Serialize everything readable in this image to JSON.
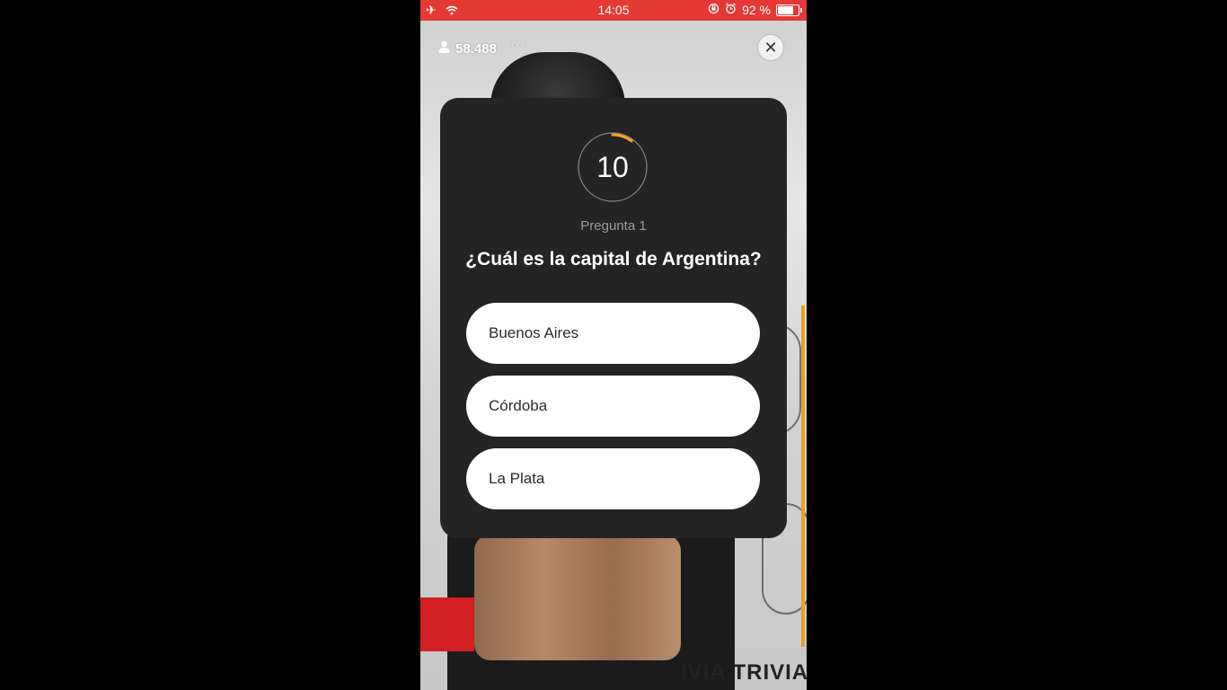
{
  "status_bar": {
    "time": "14:05",
    "battery_text": "92 %",
    "battery_level": 0.92,
    "icons": [
      "airplane-icon",
      "wifi-icon",
      "orientation-lock-icon",
      "alarm-icon",
      "battery-icon"
    ]
  },
  "header": {
    "viewers": "58.488",
    "viewers_icon": "person-icon",
    "like_icon": "heart-icon",
    "close_icon": "close-icon"
  },
  "background_text": "IVIA TRIVIA",
  "quiz": {
    "timer_value": "10",
    "timer_progress": 0.1,
    "timer_color": "#f5a623",
    "question_number": "Pregunta 1",
    "question": "¿Cuál es la capital de Argentina?",
    "answers": [
      "Buenos Aires",
      "Córdoba",
      "La Plata"
    ]
  },
  "colors": {
    "status_bar": "#e53935",
    "card": "#242424",
    "answer_bg": "#ffffff"
  }
}
